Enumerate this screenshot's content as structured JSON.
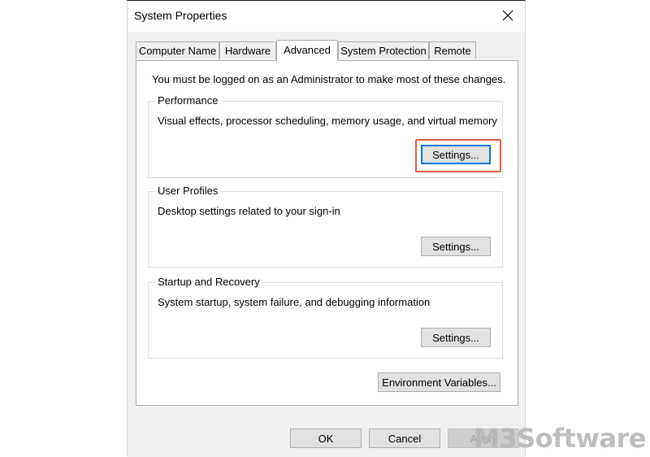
{
  "window": {
    "title": "System Properties",
    "close_icon": "close-icon"
  },
  "tabs": [
    {
      "label": "Computer Name",
      "active": false
    },
    {
      "label": "Hardware",
      "active": false
    },
    {
      "label": "Advanced",
      "active": true
    },
    {
      "label": "System Protection",
      "active": false
    },
    {
      "label": "Remote",
      "active": false
    }
  ],
  "advanced": {
    "notice": "You must be logged on as an Administrator to make most of these changes.",
    "performance": {
      "title": "Performance",
      "description": "Visual effects, processor scheduling, memory usage, and virtual memory",
      "button": "Settings..."
    },
    "user_profiles": {
      "title": "User Profiles",
      "description": "Desktop settings related to your sign-in",
      "button": "Settings..."
    },
    "startup_recovery": {
      "title": "Startup and Recovery",
      "description": "System startup, system failure, and debugging information",
      "button": "Settings..."
    },
    "env_button": "Environment Variables..."
  },
  "footer": {
    "ok": "OK",
    "cancel": "Cancel",
    "apply": "Apply"
  },
  "watermark": "M3Software",
  "colors": {
    "highlight": "#e05a47",
    "focus": "#0078d7",
    "dialog_bg": "#f0f0f0"
  }
}
